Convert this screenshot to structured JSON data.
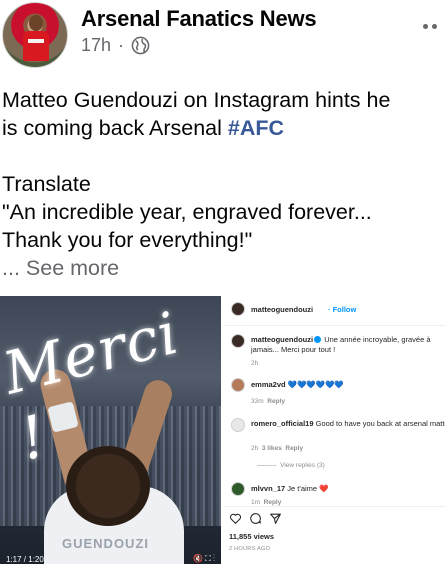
{
  "header": {
    "page_name": "Arsenal Fanatics News",
    "time": "17h",
    "separator": "·",
    "privacy_icon": "globe-icon",
    "more_icon": "more-options-icon"
  },
  "post": {
    "line1": "Matteo Guendouzi on Instagram hints he",
    "line2_text": "is coming back Arsenal ",
    "hashtag": "#AFC",
    "translate_label": "Translate",
    "quote_line1": "\"An incredible year, engraved forever...",
    "quote_line2": "Thank you for everything!\"",
    "see_more": "... See more"
  },
  "photo": {
    "overlay_text": "Merci !",
    "shirt_text": "GUENDOUZI",
    "video_time": "1:17 / 1:20",
    "video_icons": "🔇 ⛶ ⋮"
  },
  "instagram": {
    "account": "matteoguendouzi",
    "follow_sep": "·",
    "follow_label": "Follow",
    "caption_user": "matteoguendouzi",
    "caption_text": "Une année incroyable, gravée à jamais... Merci pour tout !",
    "caption_time": "2h",
    "comments": [
      {
        "user": "emma2vd",
        "text": "💙💙💙💙💙💙",
        "time": "33m",
        "reply": "Reply"
      },
      {
        "user": "romero_official19",
        "text": "Good to have you back at arsenal matte",
        "time": "2h",
        "likes": "3 likes",
        "reply": "Reply",
        "view_replies": "View replies (3)"
      },
      {
        "user": "mlvvn_17",
        "text": "Je t'aime ❤️",
        "time": "1m",
        "reply": "Reply"
      }
    ],
    "views": "11,855 views",
    "posted": "2 HOURS AGO",
    "action_icons": [
      "heart-icon",
      "comment-icon",
      "share-icon"
    ]
  }
}
